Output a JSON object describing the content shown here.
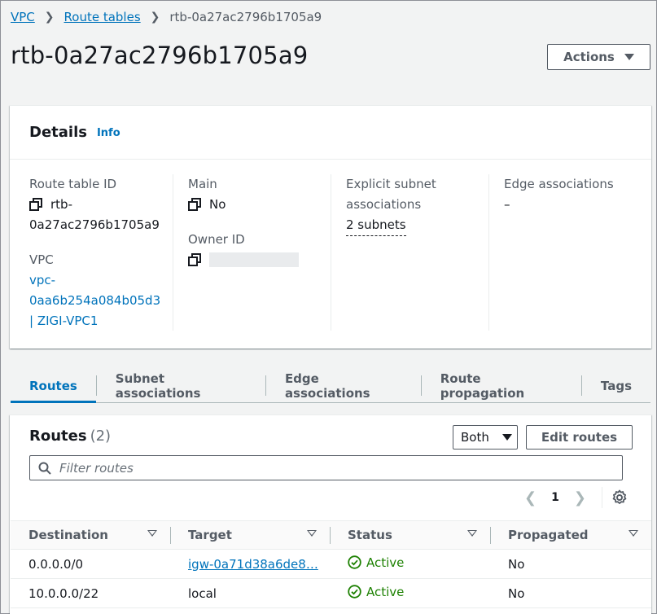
{
  "breadcrumb": {
    "items": [
      "VPC",
      "Route tables"
    ],
    "current": "rtb-0a27ac2796b1705a9"
  },
  "page_title": "rtb-0a27ac2796b1705a9",
  "actions_label": "Actions",
  "details": {
    "title": "Details",
    "info_label": "Info",
    "route_table_id_label": "Route table ID",
    "route_table_id_line1": "rtb-",
    "route_table_id_line2": "0a27ac2796b1705a9",
    "vpc_label": "VPC",
    "vpc_line1": "vpc-",
    "vpc_line2": "0aa6b254a084b05d3",
    "vpc_line3": "| ZIGI-VPC1",
    "main_label": "Main",
    "main_value": "No",
    "owner_id_label": "Owner ID",
    "explicit_label_line1": "Explicit subnet",
    "explicit_label_line2": "associations",
    "explicit_value": "2 subnets",
    "edge_label": "Edge associations",
    "edge_value": "–"
  },
  "tabs": [
    "Routes",
    "Subnet associations",
    "Edge associations",
    "Route propagation",
    "Tags"
  ],
  "routes": {
    "title": "Routes",
    "count": "(2)",
    "filter_select": "Both",
    "edit_label": "Edit routes",
    "filter_placeholder": "Filter routes",
    "page": "1",
    "columns": [
      "Destination",
      "Target",
      "Status",
      "Propagated"
    ],
    "rows": [
      {
        "destination": "0.0.0.0/0",
        "target": "igw-0a71d38a6de8…",
        "status": "Active",
        "propagated": "No"
      },
      {
        "destination": "10.0.0.0/22",
        "target": "local",
        "status": "Active",
        "propagated": "No"
      }
    ]
  },
  "colors": {
    "link": "#0073bb",
    "active": "#1d8102"
  }
}
